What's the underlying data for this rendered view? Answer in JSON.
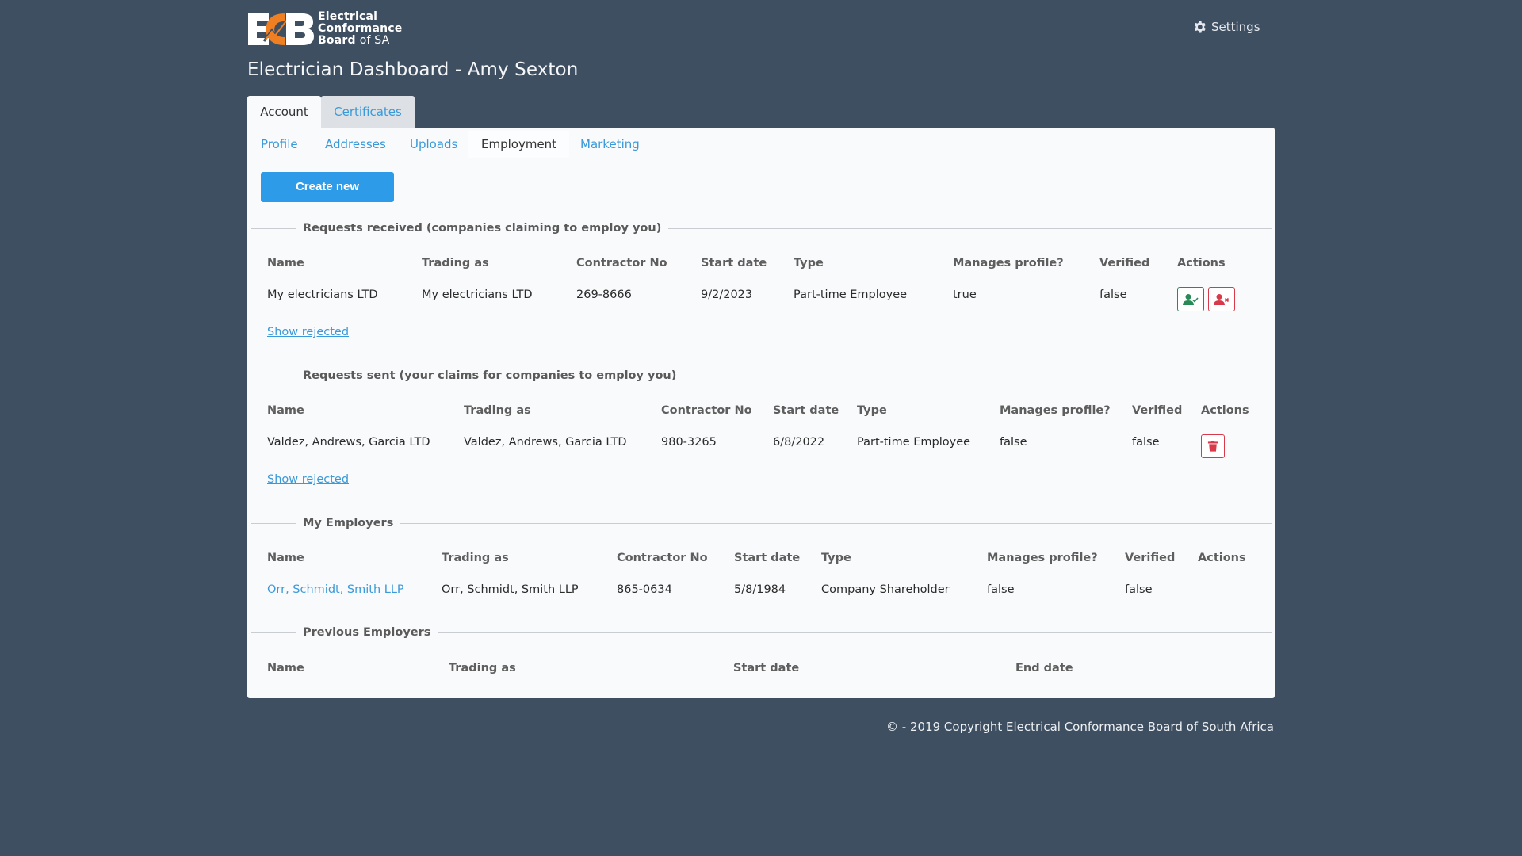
{
  "header": {
    "logo": {
      "letters": "ECB",
      "line1": "Electrical",
      "line2": "Conformance",
      "line3_bold": "Board",
      "line3_light": "of SA"
    },
    "settings_label": "Settings",
    "settings_icon": "gear-icon",
    "page_title": "Electrician Dashboard - Amy Sexton"
  },
  "top_tabs": [
    {
      "label": "Account",
      "active": true
    },
    {
      "label": "Certificates",
      "active": false
    }
  ],
  "sub_tabs": [
    {
      "label": "Profile",
      "active": false
    },
    {
      "label": "Addresses",
      "active": false
    },
    {
      "label": "Uploads",
      "active": false
    },
    {
      "label": "Employment",
      "active": true
    },
    {
      "label": "Marketing",
      "active": false
    }
  ],
  "create_button_label": "Create new",
  "sections": {
    "requests_received": {
      "title": "Requests received (companies claiming to employ you)",
      "columns": [
        "Name",
        "Trading as",
        "Contractor No",
        "Start date",
        "Type",
        "Manages profile?",
        "Verified",
        "Actions"
      ],
      "rows": [
        {
          "name": "My electricians LTD",
          "trading_as": "My electricians LTD",
          "contractor_no": "269-8666",
          "start_date": "9/2/2023",
          "type": "Part-time Employee",
          "manages_profile": "true",
          "verified": "false",
          "actions": [
            "accept-user-icon",
            "reject-user-icon"
          ]
        }
      ],
      "show_rejected": "Show rejected"
    },
    "requests_sent": {
      "title": "Requests sent (your claims for companies to employ you)",
      "columns": [
        "Name",
        "Trading as",
        "Contractor No",
        "Start date",
        "Type",
        "Manages profile?",
        "Verified",
        "Actions"
      ],
      "rows": [
        {
          "name": "Valdez, Andrews, Garcia LTD",
          "trading_as": "Valdez, Andrews, Garcia LTD",
          "contractor_no": "980-3265",
          "start_date": "6/8/2022",
          "type": "Part-time Employee",
          "manages_profile": "false",
          "verified": "false",
          "actions": [
            "trash-icon"
          ]
        }
      ],
      "show_rejected": "Show rejected"
    },
    "my_employers": {
      "title": "My Employers",
      "columns": [
        "Name",
        "Trading as",
        "Contractor No",
        "Start date",
        "Type",
        "Manages profile?",
        "Verified",
        "Actions"
      ],
      "rows": [
        {
          "name": "Orr, Schmidt, Smith LLP",
          "trading_as": "Orr, Schmidt, Smith LLP",
          "contractor_no": "865-0634",
          "start_date": "5/8/1984",
          "type": "Company Shareholder",
          "manages_profile": "false",
          "verified": "false"
        }
      ]
    },
    "previous_employers": {
      "title": "Previous Employers",
      "columns": [
        "Name",
        "Trading as",
        "Start date",
        "End date"
      ],
      "rows": []
    }
  },
  "colors": {
    "background": "#3f4f62",
    "link": "#3a9ad9",
    "primary_button": "#2e9be8",
    "success": "#2a8a57",
    "danger": "#d93a4a",
    "logo_orange": "#f07f22"
  },
  "footer": "© - 2019 Copyright Electrical Conformance Board of South Africa"
}
